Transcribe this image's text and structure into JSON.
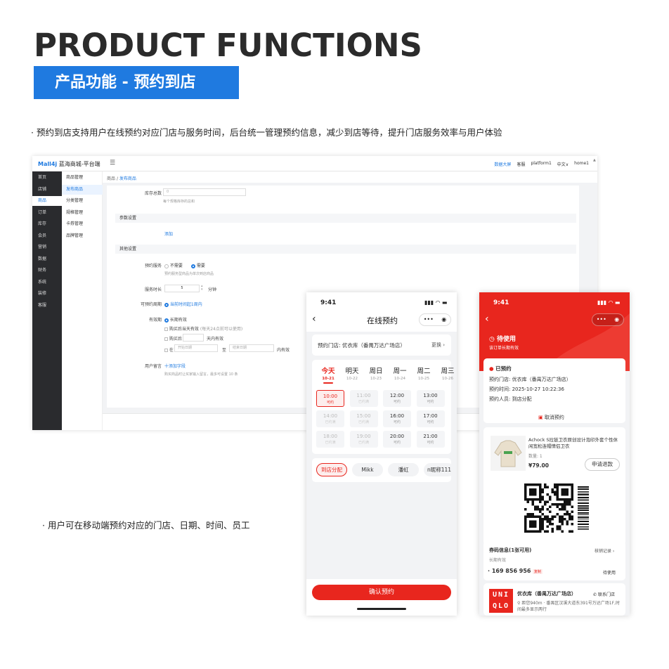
{
  "hero": {
    "title": "PRODUCT FUNCTIONS",
    "subtitle": "产品功能 - 预约到店",
    "desc1": "· 预约到店支持用户在线预约对应门店与服务时间，后台统一管理预约信息，减少到店等待，提升门店服务效率与用户体验",
    "desc2": "· 用户可在移动端预约对应的门店、日期、时间、员工"
  },
  "admin": {
    "logo_brand": "Mall4j",
    "logo_name": "蓝海商城-平台端",
    "menu_icon": "☰",
    "top_right": [
      "数据大屏",
      "客服",
      "platform1",
      "中文∨",
      "home1"
    ],
    "main_nav": [
      "首页",
      "店铺",
      "商品",
      "订单",
      "库存",
      "会员",
      "营销",
      "数据",
      "财务",
      "系统",
      "装修",
      "客服"
    ],
    "main_nav_active": "商品",
    "sub_nav": [
      "商品管理",
      "发布商品",
      "分类管理",
      "规格管理",
      "卡券管理",
      "品牌管理"
    ],
    "sub_nav_active": "发布商品",
    "breadcrumb": {
      "root": "商品",
      "sep": "/",
      "current": "发布商品"
    },
    "form": {
      "stock_label": "库存总数",
      "stock_value": "0",
      "stock_hint": "每个规格库存的总和",
      "params_section": "参数设置",
      "add_link": "添加",
      "other_section": "其他设置",
      "booking_label": "预约服务",
      "booking_no": "不需要",
      "booking_yes": "需要",
      "booking_hint": "预约服务型商品为单次到店商品",
      "duration_label": "服务时长",
      "duration_value": "5",
      "duration_unit": "分钟",
      "period_label": "可预约周期",
      "period_value": "当前时间起1周内",
      "validity_label": "有效期",
      "validity_opt1": "长期有效",
      "validity_opt2": "购买后当天有效",
      "validity_opt2_hint": "(每天24点前可以使用)",
      "validity_opt3_pre": "购买后",
      "validity_opt3_post": "天内有效",
      "validity_opt4_pre": "在",
      "start_placeholder": "开始日期",
      "range_sep": "至",
      "end_placeholder": "结束日期",
      "validity_opt4_post": "内有效",
      "note_label": "用户留言",
      "note_link": "十添加字段",
      "note_hint": "购买商品时让买家输入留言，最多可设置 10 条"
    }
  },
  "phone1": {
    "time": "9:41",
    "status_icons": "▮▮▮ ◠ ▬",
    "back_icon": "‹",
    "title": "在线预约",
    "capsule_dots": "•••",
    "capsule_target": "◉",
    "store_label": "预约门店: 优衣库（番禺万达广场店）",
    "change": "更换 ›",
    "days": [
      {
        "name": "今天",
        "date": "10-21"
      },
      {
        "name": "明天",
        "date": "10-22"
      },
      {
        "name": "周日",
        "date": "10-23"
      },
      {
        "name": "周一",
        "date": "10-24"
      },
      {
        "name": "周二",
        "date": "10-25"
      },
      {
        "name": "周三",
        "date": "10-26"
      }
    ],
    "selected_day": 0,
    "slots": [
      {
        "time": "10:00",
        "status": "可约",
        "state": "sel"
      },
      {
        "time": "11:00",
        "status": "已约满",
        "state": "dis"
      },
      {
        "time": "12:00",
        "status": "可约",
        "state": "ok"
      },
      {
        "time": "13:00",
        "status": "可约",
        "state": "ok"
      },
      {
        "time": "14:00",
        "status": "已约满",
        "state": "dis"
      },
      {
        "time": "15:00",
        "status": "已约满",
        "state": "dis"
      },
      {
        "time": "16:00",
        "status": "可约",
        "state": "ok"
      },
      {
        "time": "17:00",
        "status": "可约",
        "state": "ok"
      },
      {
        "time": "18:00",
        "status": "已约满",
        "state": "dis"
      },
      {
        "time": "19:00",
        "status": "已约满",
        "state": "dis"
      },
      {
        "time": "20:00",
        "status": "可约",
        "state": "ok"
      },
      {
        "time": "21:00",
        "status": "可约",
        "state": "ok"
      }
    ],
    "staff": [
      "到店分配",
      "Mikk",
      "潘虹",
      "n昵称111"
    ],
    "confirm": "确认预约"
  },
  "phone2": {
    "time": "9:41",
    "status_icons": "▮▮▮ ◠ ▬",
    "back_icon": "‹",
    "capsule_dots": "•••",
    "capsule_target": "◉",
    "status_title": "待使用",
    "status_sub": "该订单长期有效",
    "booked_title": "已预约",
    "store_line": "预约门店: 优衣库（番禺万达广场店）",
    "time_line": "预约时间: 2025-10-27 10:22:36",
    "person_line": "预约人员: 到店分配",
    "cancel": "取消预约",
    "product_name": "Achock S拉链卫衣原创设计泡印外套个性休闲宽松连帽情侣卫衣",
    "qty": "数量: 1",
    "price": "¥79.00",
    "refund": "申请退款",
    "coupon_title": "券码信息(1张可用)",
    "verify_record": "核销记录 ›",
    "long_valid": "长期有效",
    "code": "· 169 856 956",
    "copy": "复制",
    "pending": "待使用",
    "store_name": "优衣库（番禺万达广场店）",
    "contact": "联系门店",
    "address": "距您940m · 番禺区汉溪大道东391号万达广场1F,时间最多显示两行",
    "logo_text": "UNIQLO",
    "accent": "#e8261e"
  }
}
